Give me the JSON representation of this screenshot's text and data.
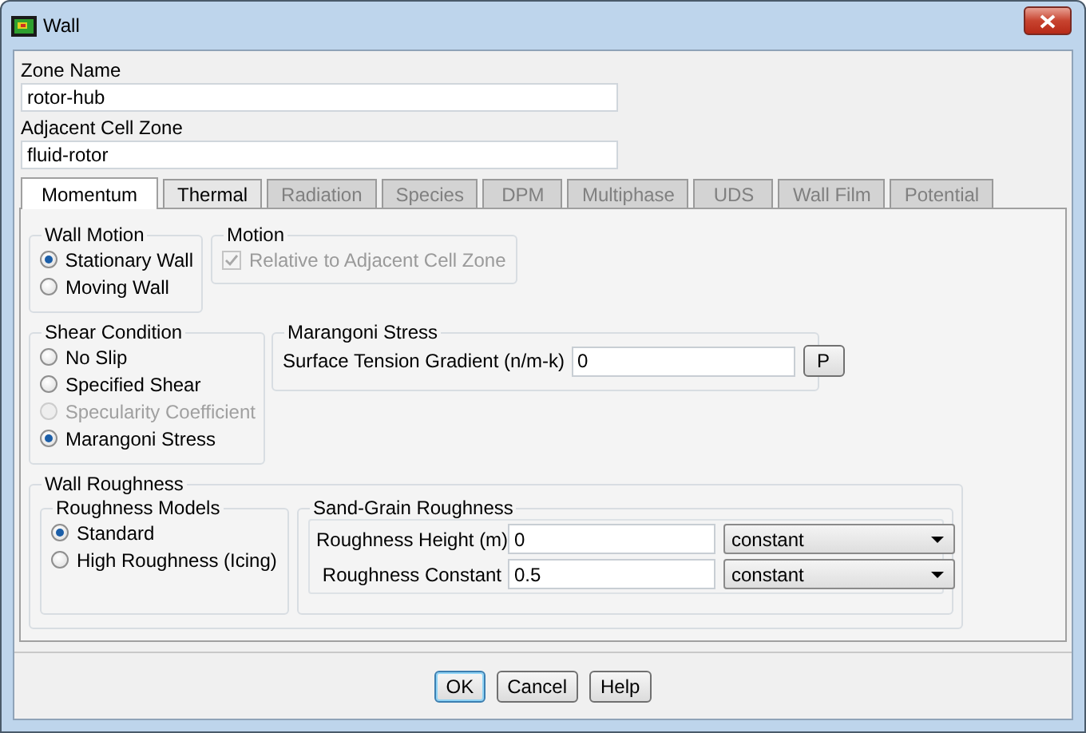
{
  "window": {
    "title": "Wall"
  },
  "zone_name": {
    "label": "Zone Name",
    "value": "rotor-hub"
  },
  "adjacent_cell_zone": {
    "label": "Adjacent Cell Zone",
    "value": "fluid-rotor"
  },
  "tabs": [
    {
      "label": "Momentum",
      "selected": true,
      "disabled": false
    },
    {
      "label": "Thermal",
      "selected": false,
      "disabled": false
    },
    {
      "label": "Radiation",
      "selected": false,
      "disabled": true
    },
    {
      "label": "Species",
      "selected": false,
      "disabled": true
    },
    {
      "label": "DPM",
      "selected": false,
      "disabled": true
    },
    {
      "label": "Multiphase",
      "selected": false,
      "disabled": true
    },
    {
      "label": "UDS",
      "selected": false,
      "disabled": true
    },
    {
      "label": "Wall Film",
      "selected": false,
      "disabled": true
    },
    {
      "label": "Potential",
      "selected": false,
      "disabled": true
    }
  ],
  "wall_motion": {
    "title": "Wall Motion",
    "options": [
      {
        "label": "Stationary Wall",
        "selected": true,
        "disabled": false
      },
      {
        "label": "Moving Wall",
        "selected": false,
        "disabled": false
      }
    ]
  },
  "motion": {
    "title": "Motion",
    "checkbox": {
      "label": "Relative to Adjacent Cell Zone",
      "checked": true,
      "disabled": true
    }
  },
  "shear_condition": {
    "title": "Shear Condition",
    "options": [
      {
        "label": "No Slip",
        "selected": false,
        "disabled": false
      },
      {
        "label": "Specified Shear",
        "selected": false,
        "disabled": false
      },
      {
        "label": "Specularity Coefficient",
        "selected": false,
        "disabled": true
      },
      {
        "label": "Marangoni Stress",
        "selected": true,
        "disabled": false
      }
    ]
  },
  "marangoni_stress": {
    "title": "Marangoni Stress",
    "label": "Surface Tension Gradient (n/m-k)",
    "value": "0",
    "button": "P"
  },
  "wall_roughness": {
    "title": "Wall Roughness",
    "roughness_models": {
      "title": "Roughness Models",
      "options": [
        {
          "label": "Standard",
          "selected": true,
          "disabled": false
        },
        {
          "label": "High Roughness (Icing)",
          "selected": false,
          "disabled": false
        }
      ]
    },
    "sand_grain_roughness": {
      "title": "Sand-Grain Roughness",
      "rows": [
        {
          "label": "Roughness Height (m)",
          "value": "0",
          "method": "constant"
        },
        {
          "label": "Roughness Constant",
          "value": "0.5",
          "method": "constant"
        }
      ]
    }
  },
  "buttons": [
    {
      "label": "OK",
      "default": true
    },
    {
      "label": "Cancel",
      "default": false
    },
    {
      "label": "Help",
      "default": false
    }
  ]
}
